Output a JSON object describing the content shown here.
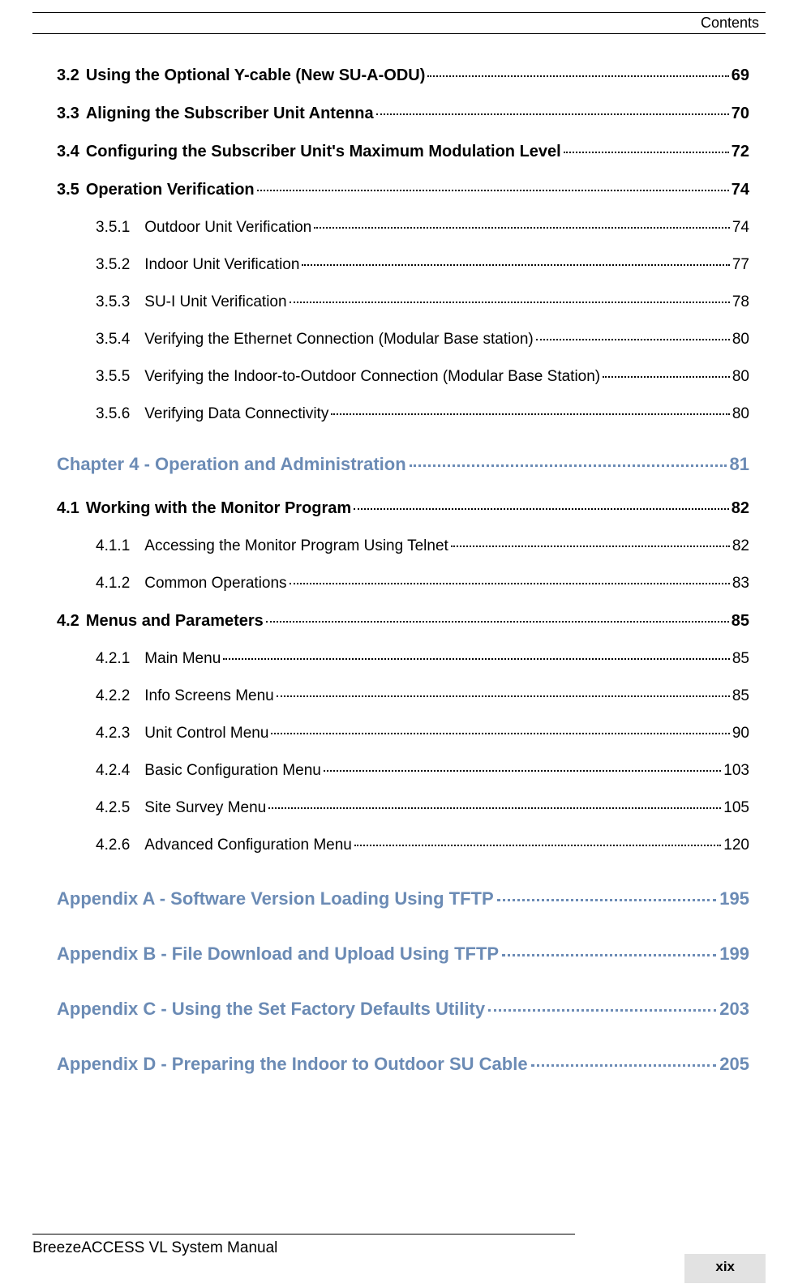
{
  "header": "Contents",
  "toc": {
    "items_l1_a": [
      {
        "num": "3.2",
        "title": "Using the Optional Y-cable (New SU-A-ODU)",
        "page": "69"
      },
      {
        "num": "3.3",
        "title": "Aligning the Subscriber Unit Antenna",
        "page": "70"
      },
      {
        "num": "3.4",
        "title": "Configuring the Subscriber Unit's Maximum Modulation Level",
        "page": "72"
      },
      {
        "num": "3.5",
        "title": "Operation Verification",
        "page": "74"
      }
    ],
    "items_l2_a": [
      {
        "num": "3.5.1",
        "title": "Outdoor Unit Verification",
        "page": "74"
      },
      {
        "num": "3.5.2",
        "title": "Indoor Unit Verification",
        "page": "77"
      },
      {
        "num": "3.5.3",
        "title": "SU-I Unit Verification",
        "page": "78"
      },
      {
        "num": "3.5.4",
        "title": "Verifying the Ethernet Connection (Modular Base station)",
        "page": "80"
      },
      {
        "num": "3.5.5",
        "title": "Verifying the Indoor-to-Outdoor Connection (Modular Base Station)",
        "page": "80"
      },
      {
        "num": "3.5.6",
        "title": "Verifying Data Connectivity",
        "page": "80"
      }
    ],
    "chapter4": {
      "title": "Chapter 4 - Operation and Administration",
      "page": "81"
    },
    "items_l1_b": [
      {
        "num": "4.1",
        "title": "Working with the Monitor Program",
        "page": "82"
      }
    ],
    "items_l2_b": [
      {
        "num": "4.1.1",
        "title": "Accessing the Monitor Program Using Telnet",
        "page": "82"
      },
      {
        "num": "4.1.2",
        "title": "Common Operations",
        "page": "83"
      }
    ],
    "items_l1_c": [
      {
        "num": "4.2",
        "title": "Menus and Parameters",
        "page": "85"
      }
    ],
    "items_l2_c": [
      {
        "num": "4.2.1",
        "title": "Main Menu",
        "page": "85"
      },
      {
        "num": "4.2.2",
        "title": "Info Screens Menu",
        "page": "85"
      },
      {
        "num": "4.2.3",
        "title": "Unit Control Menu",
        "page": "90"
      },
      {
        "num": "4.2.4",
        "title": "Basic Configuration Menu",
        "page": "103"
      },
      {
        "num": "4.2.5",
        "title": "Site Survey Menu",
        "page": "105"
      },
      {
        "num": "4.2.6",
        "title": "Advanced Configuration Menu",
        "page": "120"
      }
    ],
    "appendices": [
      {
        "title": "Appendix A - Software Version Loading Using TFTP",
        "page": "195"
      },
      {
        "title": "Appendix B - File Download and Upload Using TFTP",
        "page": "199"
      },
      {
        "title": "Appendix C - Using the Set Factory Defaults Utility",
        "page": "203"
      },
      {
        "title": "Appendix D - Preparing the Indoor to Outdoor SU Cable",
        "page": "205"
      }
    ]
  },
  "footer": "BreezeACCESS VL System Manual",
  "page_number": "xix"
}
